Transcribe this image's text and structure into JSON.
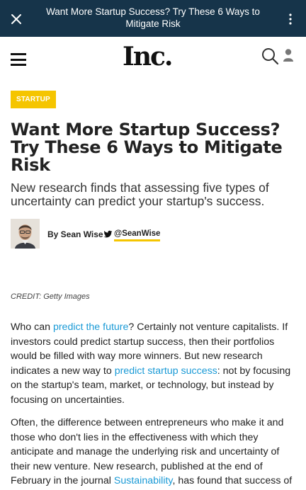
{
  "appbar": {
    "title": "Want More Startup Success? Try These 6 Ways to Mitigate Risk",
    "close_icon": "close-icon",
    "menu_icon": "more-vert-icon"
  },
  "header": {
    "logo_text": "Inc.",
    "menu_icon": "hamburger-icon",
    "search_icon": "search-icon",
    "account_icon": "user-icon"
  },
  "article": {
    "tag": "STARTUP",
    "headline": "Want More Startup Success? Try These 6 Ways to Mitigate Risk",
    "dek": "New research finds that assessing five types of uncertainty can predict your startup's success.",
    "author": "By Sean Wise",
    "twitter_handle": "@SeanWise",
    "credit": "CREDIT: Getty Images",
    "p1": {
      "t1": "Who can ",
      "link1": "predict the future",
      "t2": "? Certainly not venture capitalists. If investors could predict startup success, then their portfolios would be filled with way more winners. But new research indicates a new way to ",
      "link2": "predict startup success",
      "t3": ": not by focusing on the startup's team, market, or technology, but instead by focusing on uncertainties."
    },
    "p2": {
      "t1": "Often, the difference between entrepreneurs who make it and those who don't lies in the effectiveness with which they anticipate and manage the underlying risk and uncertainty of their new venture. New research, published at the end of February in the journal ",
      "link1": "Sustainability",
      "t2": ", has found that success of"
    }
  },
  "colors": {
    "appbar_bg": "#16344a",
    "accent": "#f5c500",
    "link": "#1a9ad6"
  }
}
